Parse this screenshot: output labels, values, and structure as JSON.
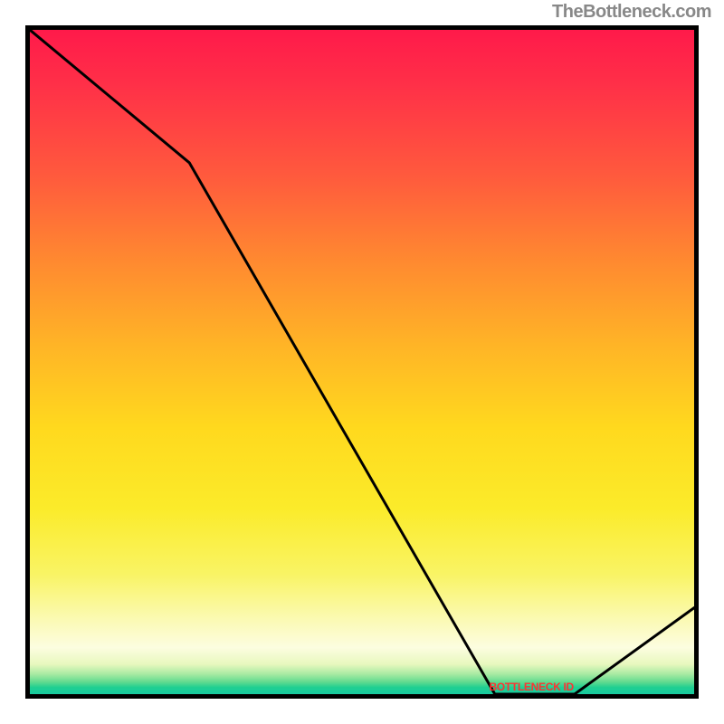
{
  "attribution": "TheBottleneck.com",
  "bottleneck_label": "BOTTLENECK ID",
  "chart_data": {
    "type": "line",
    "title": "",
    "xlabel": "",
    "ylabel": "",
    "xlim": [
      0,
      100
    ],
    "ylim": [
      0,
      100
    ],
    "series": [
      {
        "name": "bottleneck-curve",
        "x": [
          0,
          24,
          70,
          82,
          100
        ],
        "y": [
          100,
          80,
          0,
          0,
          13
        ]
      }
    ],
    "gradient_stops": [
      {
        "pct": 0,
        "color": "#ff1a4a"
      },
      {
        "pct": 8,
        "color": "#ff2f48"
      },
      {
        "pct": 22,
        "color": "#ff5a3d"
      },
      {
        "pct": 35,
        "color": "#ff8a30"
      },
      {
        "pct": 48,
        "color": "#ffb626"
      },
      {
        "pct": 60,
        "color": "#ffd91e"
      },
      {
        "pct": 72,
        "color": "#fbeb2a"
      },
      {
        "pct": 82,
        "color": "#f9f465"
      },
      {
        "pct": 89,
        "color": "#fbfab6"
      },
      {
        "pct": 93,
        "color": "#fcfde0"
      },
      {
        "pct": 95.5,
        "color": "#e8f8be"
      },
      {
        "pct": 97,
        "color": "#a7eaa2"
      },
      {
        "pct": 98.2,
        "color": "#5fda8f"
      },
      {
        "pct": 99,
        "color": "#1fcf91"
      },
      {
        "pct": 100,
        "color": "#19caa0"
      }
    ],
    "bottleneck_range_x": [
      70,
      82
    ]
  }
}
